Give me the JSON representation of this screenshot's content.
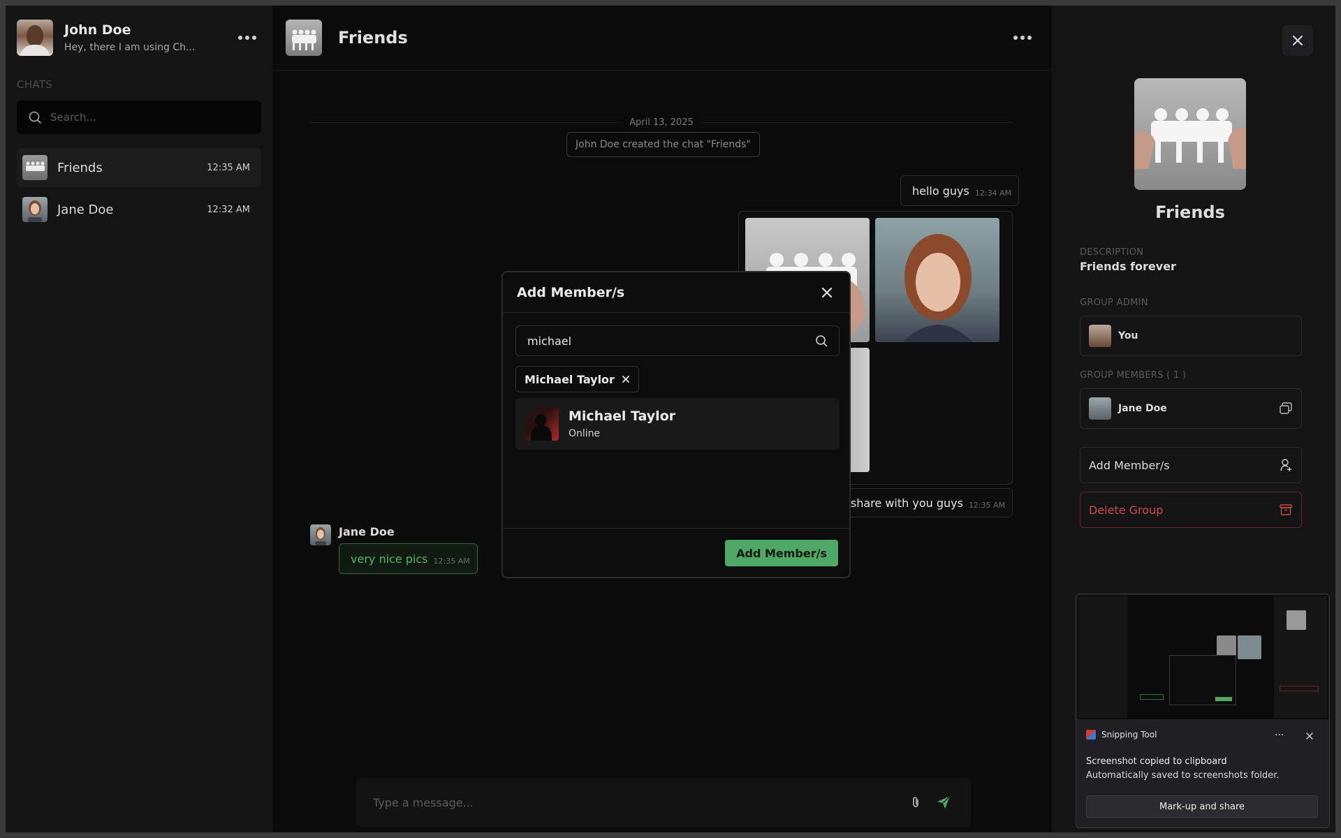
{
  "sidebar": {
    "user_name": "John Doe",
    "user_status": "Hey, there I am using Ch...",
    "section_label": "CHATS",
    "search_placeholder": "Search...",
    "chats": [
      {
        "name": "Friends",
        "time": "12:35 AM",
        "active": true
      },
      {
        "name": "Jane Doe",
        "time": "12:32 AM",
        "active": false
      }
    ]
  },
  "main": {
    "title": "Friends",
    "date_divider": "April 13, 2025",
    "system_message": "John Doe created the chat \"Friends\"",
    "messages": {
      "out1": {
        "text": "hello guys",
        "time": "12:34 AM"
      },
      "out2": {
        "text": "o share with you guys",
        "time": "12:35 AM"
      },
      "in1": {
        "sender": "Jane Doe",
        "text": "very nice pics",
        "time": "12:35 AM"
      }
    },
    "composer_placeholder": "Type a message..."
  },
  "modal": {
    "title": "Add Member/s",
    "search_value": "michael",
    "chip_label": "Michael Taylor",
    "result": {
      "name": "Michael Taylor",
      "status": "Online"
    },
    "submit_label": "Add Member/s"
  },
  "panel": {
    "group_name": "Friends",
    "description_label": "DESCRIPTION",
    "description": "Friends forever",
    "admin_label": "GROUP ADMIN",
    "admin_name": "You",
    "members_label": "GROUP MEMBERS ( 1 )",
    "member_name": "Jane Doe",
    "add_member_label": "Add Member/s",
    "delete_group_label": "Delete Group"
  },
  "toast": {
    "app_name": "Snipping Tool",
    "more": "···",
    "title": "Screenshot copied to clipboard",
    "subtitle": "Automatically saved to screenshots folder.",
    "button_label": "Mark-up and share"
  },
  "colors": {
    "accent_green": "#4fa865",
    "danger_red": "#d04a4f",
    "background": "#0b0b0c"
  }
}
